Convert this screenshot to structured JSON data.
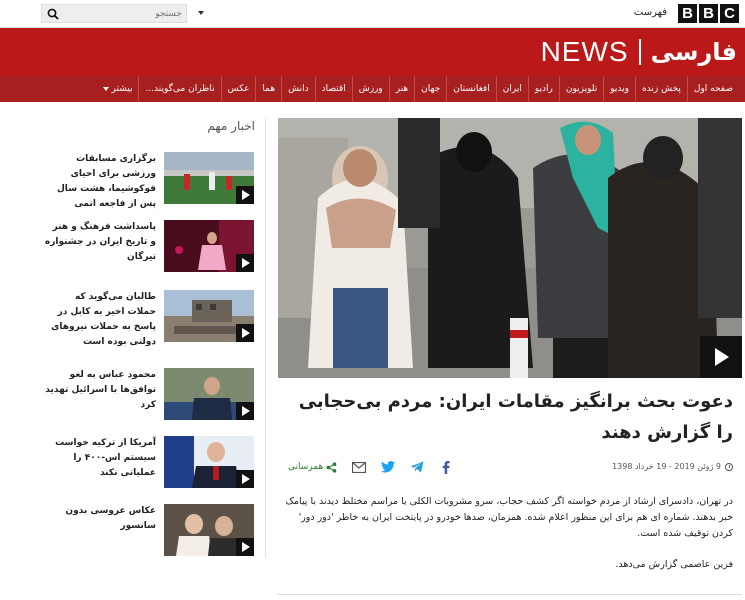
{
  "topbar": {
    "logo": [
      "B",
      "B",
      "C"
    ],
    "menu_label": "فهرست",
    "search_placeholder": "جستجو"
  },
  "masthead": {
    "news": "NEWS",
    "farsi": "فارسی",
    "color": "#bb1919"
  },
  "nav": {
    "items": [
      "صفحه اول",
      "پخش زنده",
      "ویدیو",
      "تلویزیون",
      "رادیو",
      "ایران",
      "افغانستان",
      "جهان",
      "هنر",
      "ورزش",
      "اقتصاد",
      "دانش",
      "هما",
      "عکس",
      "ناظران می‌گویند..."
    ],
    "more_label": "بیشتر"
  },
  "feature": {
    "headline": "دعوت بحث برانگیز مقامات ایران: مردم بی‌حجابی را گزارش دهند",
    "date": "9 ژوئن 2019 - 19 خرداد 1398",
    "share_label": "همرسانی",
    "body": "در تهران، دادسرای ارشاد از مردم خواسته اگر کشف حجاب، سرو مشروبات الکلی یا مراسم مختلط دیدند با پیامک خبر بدهند. شماره ای هم برای این منظور اعلام شده. همزمان، صدها خودرو در پایتخت ایران به خاطر 'دور دور' کردن توقیف شده است.",
    "byline": "فرین عاصمی گزارش می‌دهد."
  },
  "sidebar": {
    "title": "اخبار مهم",
    "items": [
      {
        "text": "برگزاری مسابقات ورزشی برای احیای فوکوشیما، هشت سال پس از فاجعه اتمی"
      },
      {
        "text": "پاسداشت فرهنگ و هنر و تاریخ ایران در جشنواره تیرگان"
      },
      {
        "text": "طالبان می‌گوید که حملات اخیر به کابل در پاسخ به حملات نیروهای دولتی بوده است"
      },
      {
        "text": "محمود عباس به لغو توافق‌ها با اسرائیل تهدید کرد"
      },
      {
        "text": "آمریکا از ترکیه خواست سیستم اس-۴۰۰ را عملیاتی نکند"
      },
      {
        "text": "عکاس عروسی بدون سانسور"
      }
    ]
  }
}
